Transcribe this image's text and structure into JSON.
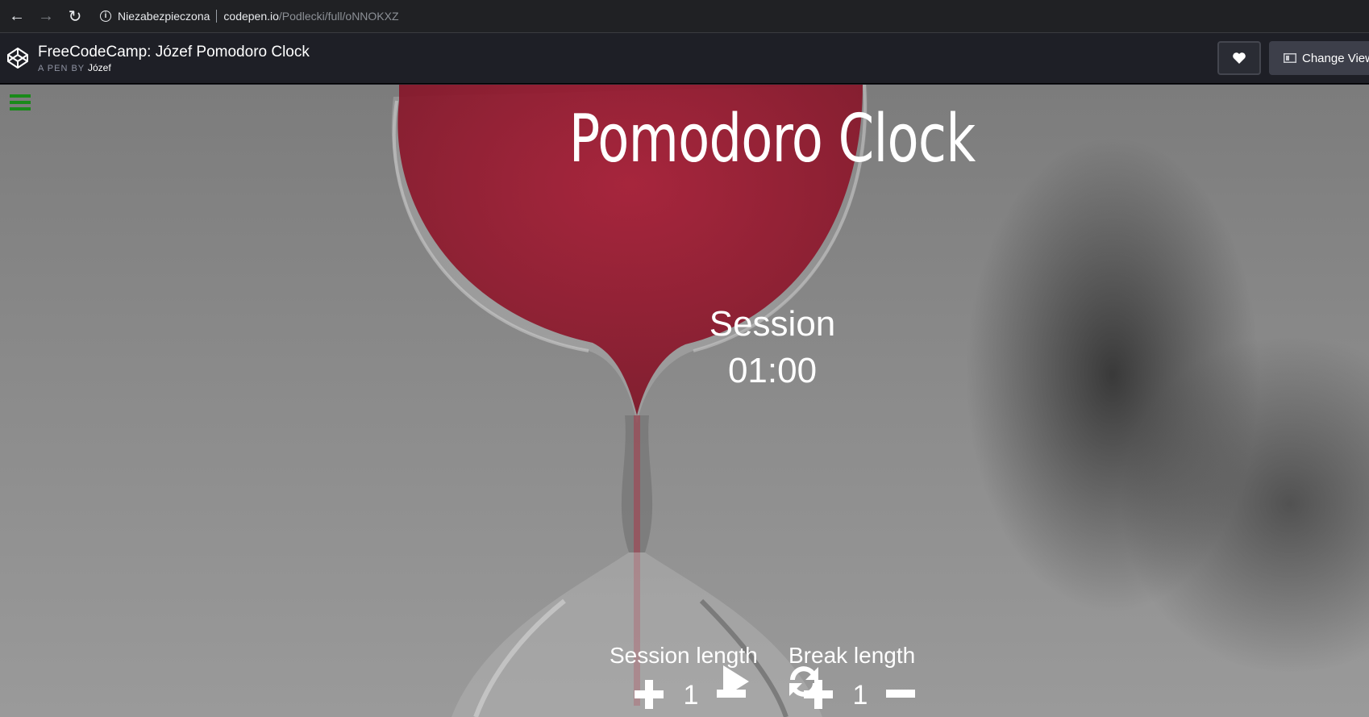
{
  "browser": {
    "security_label": "Niezabezpieczona",
    "url_host": "codepen.io",
    "url_path": "/Podlecki/full/oNNOKXZ"
  },
  "header": {
    "title": "FreeCodeCamp: Józef Pomodoro Clock",
    "byline_prefix": "A PEN BY",
    "author": "Józef",
    "change_view_label": "Change View"
  },
  "app": {
    "title": "Pomodoro Clock",
    "mode": "Session",
    "time": "01:00",
    "session_length_label": "Session length",
    "break_length_label": "Break length",
    "session_length_value": "1",
    "break_length_value": "1"
  },
  "icons": {
    "back": "back-arrow-icon",
    "forward": "forward-arrow-icon",
    "reload": "reload-icon",
    "menu": "hamburger-menu-icon",
    "play": "play-icon",
    "reset": "refresh-icon",
    "plus": "plus-icon",
    "minus": "minus-icon",
    "heart": "heart-icon",
    "change_view": "layout-icon"
  },
  "colors": {
    "menu_icon": "#1a8a1a",
    "sand": "#b2203a",
    "header_bg": "#1e1f26"
  }
}
